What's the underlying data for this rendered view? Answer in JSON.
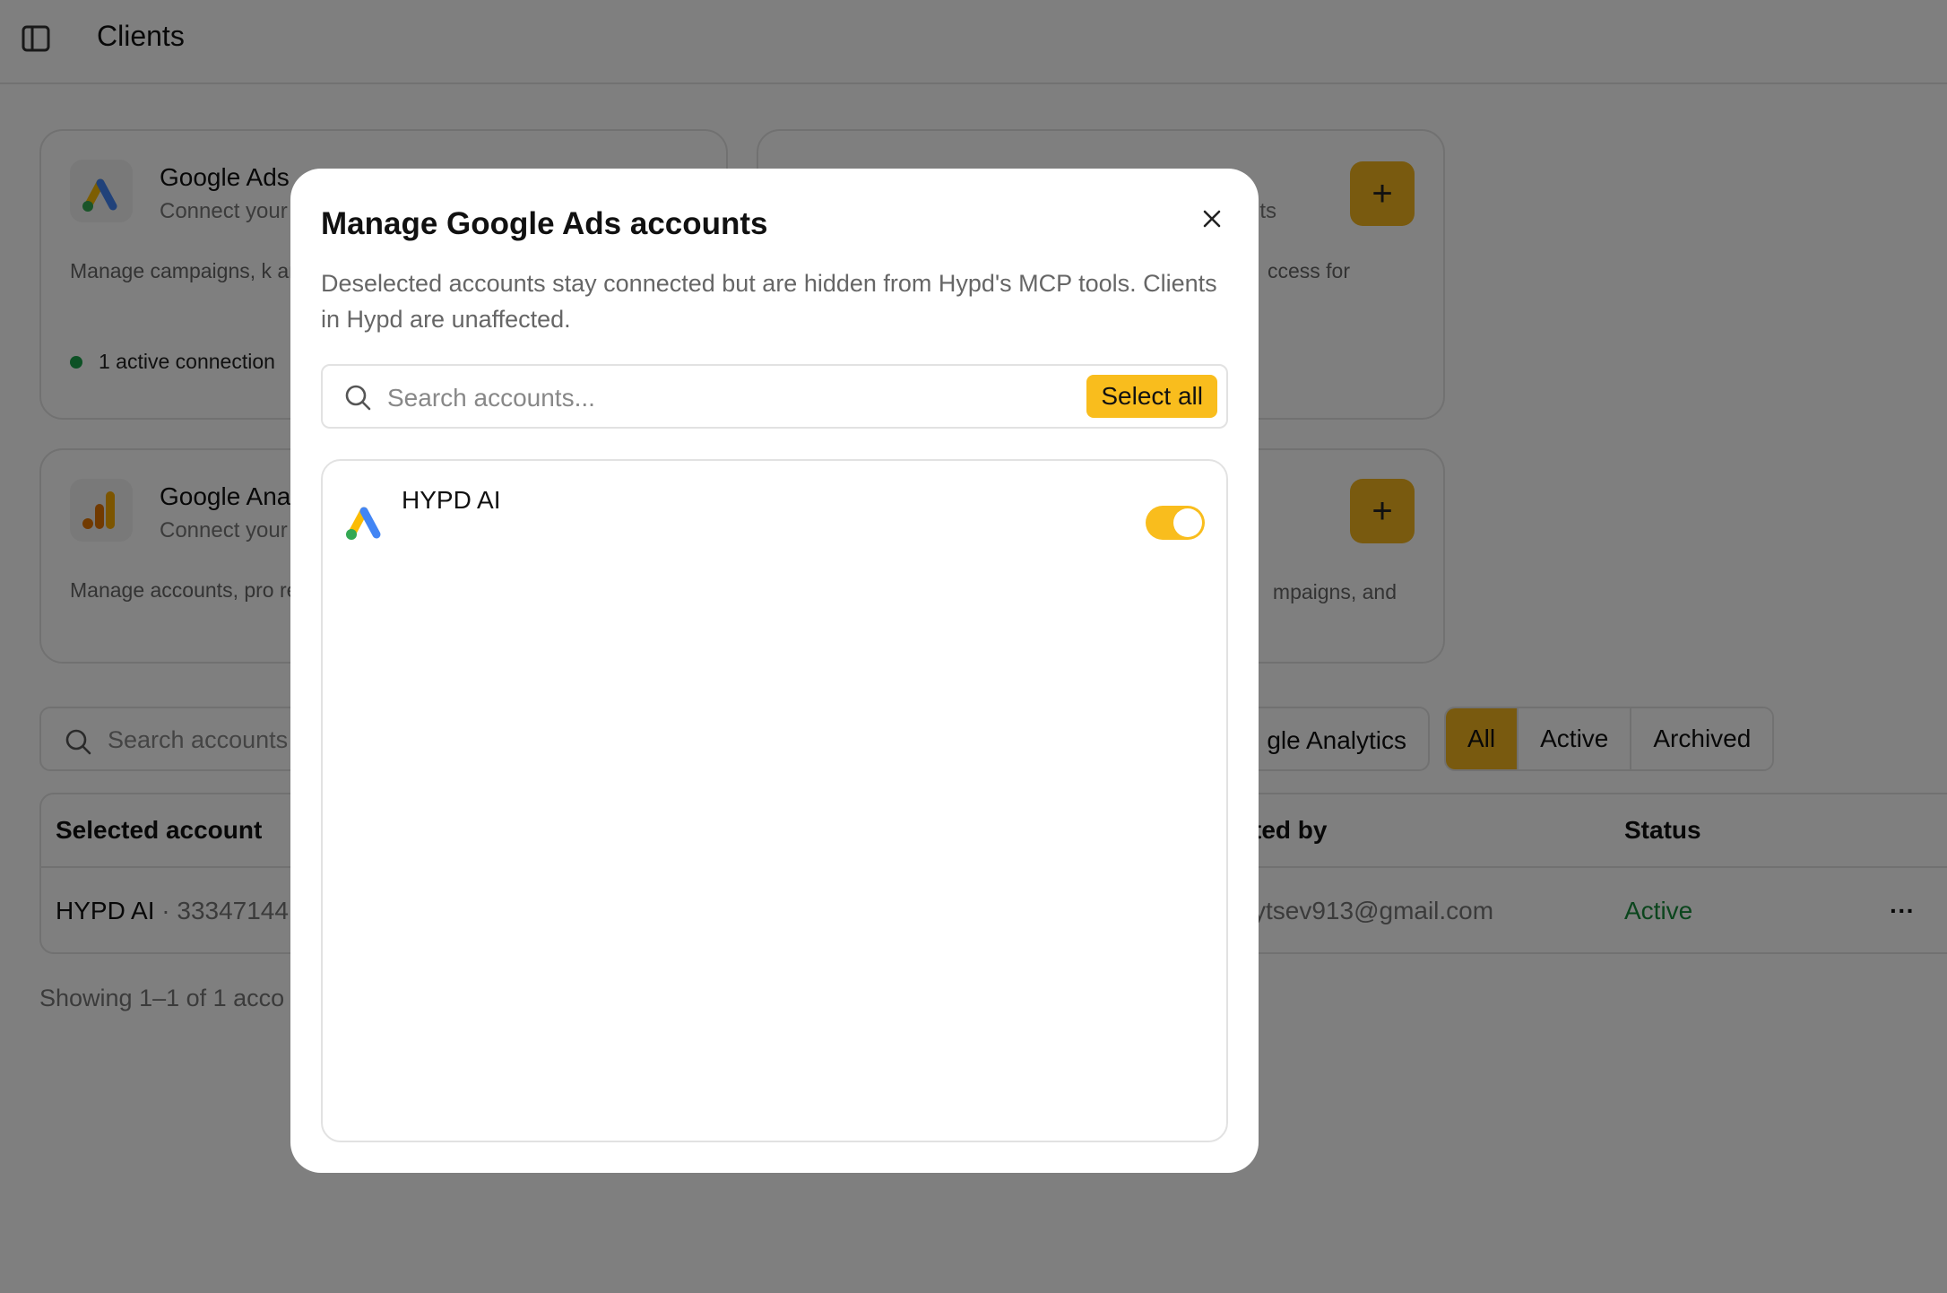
{
  "header": {
    "title": "Clients"
  },
  "cards": [
    {
      "title": "Google Ads",
      "subtitle": "Connect your",
      "description": "Manage campaigns, k analyze and optimize",
      "status": "1 active connection"
    },
    {
      "subtitle_fragment": "ts",
      "description_fragment": "ccess for",
      "add_label": "+"
    },
    {
      "title": "Google Anal",
      "subtitle": "Connect your",
      "description": "Manage accounts, pro reporting workflows."
    },
    {
      "description_fragment": "mpaigns, and",
      "add_label": "+"
    }
  ],
  "filters": {
    "search_placeholder": "Search accounts",
    "provider": "gle Analytics",
    "tabs": [
      "All",
      "Active",
      "Archived"
    ],
    "active_tab": "All"
  },
  "table": {
    "headers": {
      "account": "Selected account",
      "connected_by": "ted by",
      "status": "Status"
    },
    "rows": [
      {
        "name": "HYPD AI",
        "id": " · 33347144",
        "connected_by": "ytsev913@gmail.com",
        "status": "Active",
        "menu": "···"
      }
    ],
    "footer": "Showing 1–1 of 1 acco"
  },
  "modal": {
    "title": "Manage Google Ads accounts",
    "description": "Deselected accounts stay connected but are hidden from Hypd's MCP tools. Clients in Hypd are unaffected.",
    "search_placeholder": "Search accounts...",
    "select_all_label": "Select all",
    "accounts": [
      {
        "name": "HYPD AI",
        "enabled": true
      }
    ]
  },
  "colors": {
    "accent": "#f9bd1d",
    "status_active": "#178a3a",
    "overlay": "rgba(0,0,0,0.5)"
  },
  "icons": [
    "sidebar-toggle-icon",
    "google-ads-icon",
    "google-analytics-icon",
    "search-icon",
    "close-icon",
    "more-icon"
  ]
}
